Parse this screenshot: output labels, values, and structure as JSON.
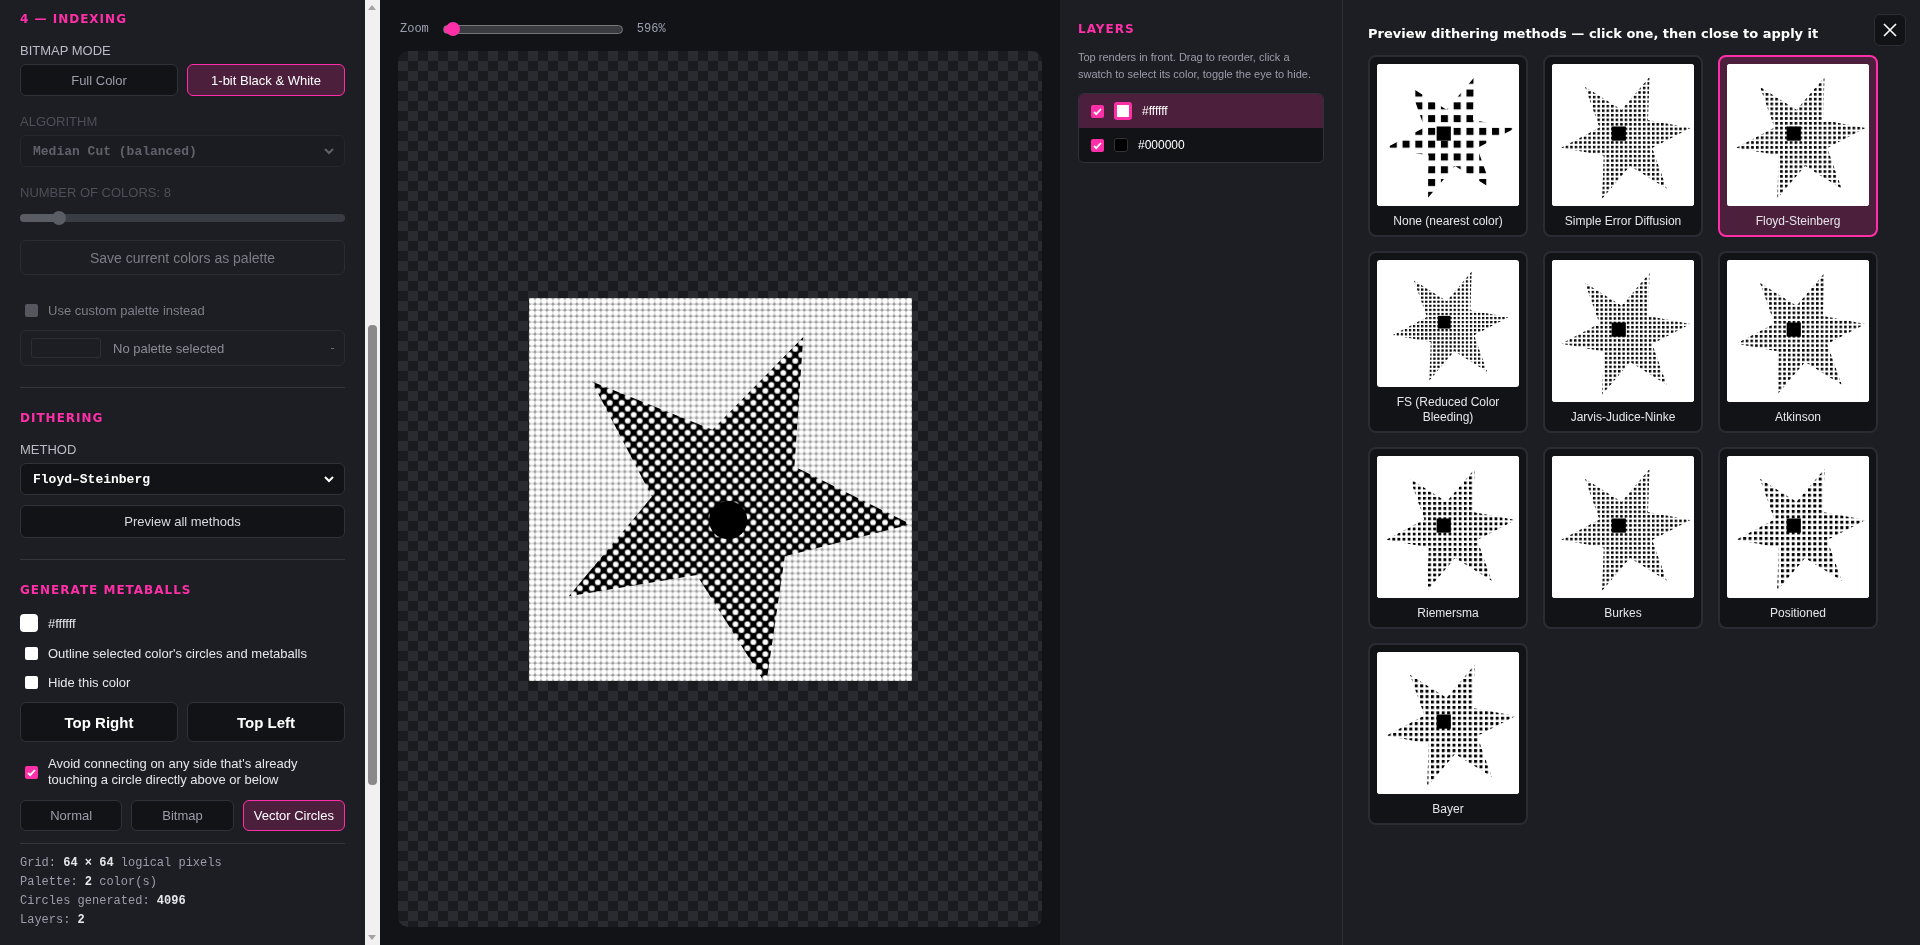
{
  "sidebar": {
    "indexing": {
      "heading": "4 — INDEXING",
      "bitmap_mode": {
        "label": "BITMAP MODE",
        "options": [
          {
            "label": "Full Color",
            "selected": false
          },
          {
            "label": "1-bit Black & White",
            "selected": true
          }
        ]
      },
      "algorithm": {
        "label": "ALGORITHM",
        "value": "Median Cut (balanced)",
        "disabled": true
      },
      "colors": {
        "label": "NUMBER OF COLORS: 8",
        "level": 0.12,
        "disabled": true
      },
      "save_button": {
        "label": "Save current colors as palette",
        "disabled": true
      },
      "custom_palette": {
        "label": "Use custom palette instead",
        "checked": false,
        "disabled": true
      },
      "palette_select": {
        "value": "No palette selected"
      }
    },
    "dithering": {
      "heading": "DITHERING",
      "method_label": "METHOD",
      "method": "Floyd–Steinberg",
      "preview_button": "Preview all methods"
    },
    "metaballs": {
      "heading": "GENERATE METABALLS",
      "color": {
        "label": "#ffffff",
        "color": "#ffffff"
      },
      "options": [
        {
          "label": "Outline selected color's circles and metaballs",
          "checked": false
        },
        {
          "label": "Hide this color",
          "checked": false
        }
      ],
      "corner_buttons": [
        "Top Right",
        "Top Left"
      ],
      "avoid": {
        "label": "Avoid connecting on any side that's already touching a circle directly above or below",
        "checked": true
      },
      "render_modes": [
        {
          "label": "Normal",
          "selected": false
        },
        {
          "label": "Bitmap",
          "selected": false
        },
        {
          "label": "Vector Circles",
          "selected": true
        }
      ]
    },
    "stats": [
      "Grid: **64 × 64** logical pixels",
      "Palette: **2** color(s)",
      "Circles generated: **4096**",
      "Layers: **2**"
    ]
  },
  "canvas": {
    "zoom": {
      "label": "Zoom",
      "level": 0.05,
      "reading": "596%"
    }
  },
  "layers": {
    "heading": "LAYERS",
    "hint": "Top renders in front. Drag to reorder, click a swatch to select its color, toggle the eye to hide.",
    "items": [
      {
        "label": "#ffffff",
        "color": "#ffffff",
        "checked": true,
        "selected": true
      },
      {
        "label": "#000000",
        "color": "#000000",
        "checked": true,
        "selected": false
      }
    ]
  },
  "dialog": {
    "title": "Preview dithering methods — click one, then close to apply it",
    "methods": [
      {
        "label": "None (nearest color)",
        "selected": false
      },
      {
        "label": "Simple Error Diffusion",
        "selected": false
      },
      {
        "label": "Floyd-Steinberg",
        "selected": true
      },
      {
        "label": "FS (Reduced Color Bleeding)",
        "selected": false
      },
      {
        "label": "Jarvis-Judice-Ninke",
        "selected": false
      },
      {
        "label": "Atkinson",
        "selected": false
      },
      {
        "label": "Riemersma",
        "selected": false
      },
      {
        "label": "Burkes",
        "selected": false
      },
      {
        "label": "Positioned",
        "selected": false
      },
      {
        "label": "Bayer",
        "selected": false
      }
    ]
  }
}
